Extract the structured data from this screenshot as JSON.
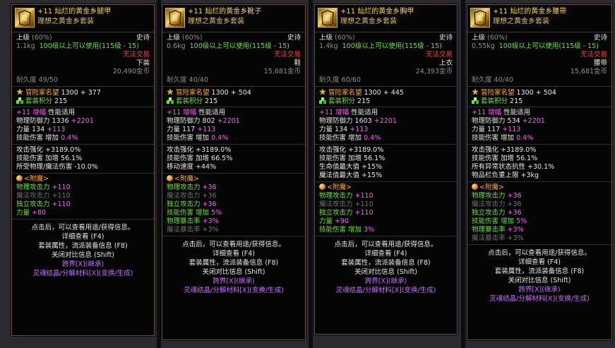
{
  "common": {
    "grade_label": "上级",
    "grade_pct": "(60%)",
    "rarity": "史诗",
    "req_level": "100级以上可以使用(115级 - 15)",
    "trade": "无法交易",
    "explorer_label": "冒险家名望",
    "set_points_label": "套装积分",
    "set_points_value": "215",
    "amp": "+11  增幅",
    "perf": "性能适用",
    "skill_dmg_label": "技能伤害",
    "skill_dmg_up": "增加",
    "skill_dmg_pct": "0.4%",
    "enchant_title": "<附魔>",
    "footer": {
      "line1": "点击后，可以查看用途/获得信息。",
      "line2": "详细查看 (F4)",
      "line3": "套装属性，流派装备信息 (F8)",
      "line4": "关闭对比信息 (Shift)",
      "line5": "跨界[X](继承)",
      "line6": "灵魂结晶/分解材料[X](变换/生成)"
    }
  },
  "tooltips": [
    {
      "title": "+11 灿烂的黄金乡腿甲",
      "subtitle": "理想之黄金乡套装",
      "weight": "1.1kg",
      "slot": "下装",
      "price": "20,490金币",
      "durability": "耐久度 49/50",
      "explorer_value": "1300 + 377",
      "def_label": "物理防御力",
      "def_base": "1336",
      "def_bonus": "+2201",
      "stat_label": "力量",
      "stat_base": "134",
      "stat_bonus": "+113",
      "bonus_lines": [
        "攻击强化 +3189.0%",
        "技能伤害 加增 56.1%",
        "所受物理/魔法伤害 -10.0%"
      ],
      "enchant": [
        {
          "label": "物理攻击力",
          "value": "+110",
          "style": "white"
        },
        {
          "label": "魔法攻击力",
          "value": "+110",
          "style": "dim"
        },
        {
          "label": "独立攻击力",
          "value": "+110",
          "style": "white"
        },
        {
          "label": "力量",
          "value": "+80",
          "style": "white"
        }
      ]
    },
    {
      "title": "+11 灿烂的黄金乡靴子",
      "subtitle": "理想之黄金乡套装",
      "weight": "0.6kg",
      "slot": "鞋",
      "price": "15,681金币",
      "durability": "耐久度 40/40",
      "explorer_value": "1300 + 504",
      "def_label": "物理防御力",
      "def_base": "802",
      "def_bonus": "+2201",
      "stat_label": "力量",
      "stat_base": "117",
      "stat_bonus": "+113",
      "bonus_lines": [
        "攻击强化 +3189.0%",
        "技能伤害 加增 66.5%",
        "移动速度 +44%"
      ],
      "enchant": [
        {
          "label": "物理攻击力",
          "value": "+36",
          "style": "white"
        },
        {
          "label": "魔法攻击力",
          "value": "+36",
          "style": "dim"
        },
        {
          "label": "独立攻击力",
          "value": "+36",
          "style": "white"
        },
        {
          "label": "技能伤害 增加",
          "value": "5%",
          "style": "white"
        },
        {
          "label": "物理暴击率",
          "value": "+3%",
          "style": "white"
        },
        {
          "label": "魔法暴击率",
          "value": "+3%",
          "style": "dim"
        }
      ]
    },
    {
      "title": "+11 灿烂的黄金乡胸甲",
      "subtitle": "理想之黄金乡套装",
      "weight": "1.4kg",
      "slot": "上衣",
      "price": "24,393金币",
      "durability": "耐久度 60/60",
      "explorer_value": "1300 + 445",
      "def_label": "物理防御力",
      "def_base": "1603",
      "def_bonus": "+2201",
      "stat_label": "力量",
      "stat_base": "134",
      "stat_bonus": "+113",
      "bonus_lines": [
        "攻击强化 +3189.0%",
        "技能伤害 加增 56.1%",
        "生命值最大值 +15%",
        "魔法值最大值 +15%"
      ],
      "enchant": [
        {
          "label": "物理攻击力",
          "value": "+110",
          "style": "white"
        },
        {
          "label": "魔法攻击力",
          "value": "+110",
          "style": "dim"
        },
        {
          "label": "独立攻击力",
          "value": "+110",
          "style": "white"
        },
        {
          "label": "力量",
          "value": "+90",
          "style": "white"
        },
        {
          "label": "技能伤害 增加",
          "value": "3%",
          "style": "white"
        }
      ]
    },
    {
      "title": "+11 灿烂的黄金乡腰带",
      "subtitle": "理想之黄金乡套装",
      "weight": "0.55kg",
      "slot": "腰带",
      "price": "15,681金币",
      "durability": "耐久度 40/40",
      "explorer_value": "1300 + 504",
      "def_label": "物理防御力",
      "def_base": "534",
      "def_bonus": "+2201",
      "stat_label": "力量",
      "stat_base": "117",
      "stat_bonus": "+113",
      "bonus_lines": [
        "攻击强化 +3189.0%",
        "技能伤害 加增 56.1%",
        "所有异常状态抗性 +30.1%",
        "物品栏负重上限 +3kg"
      ],
      "enchant": [
        {
          "label": "物理攻击力",
          "value": "+36",
          "style": "white"
        },
        {
          "label": "魔法攻击力",
          "value": "+36",
          "style": "dim"
        },
        {
          "label": "独立攻击力",
          "value": "+36",
          "style": "white"
        },
        {
          "label": "技能伤害 增加",
          "value": "5%",
          "style": "white"
        },
        {
          "label": "物理暴击率",
          "value": "+3%",
          "style": "white"
        },
        {
          "label": "魔法暴击率",
          "value": "+3%",
          "style": "dim"
        }
      ]
    }
  ]
}
